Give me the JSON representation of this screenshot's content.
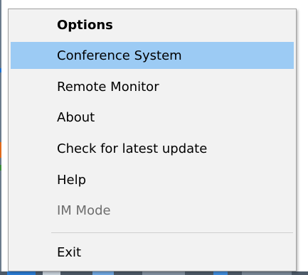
{
  "context_menu": {
    "items": [
      {
        "label": "Options",
        "style": "bold"
      },
      {
        "label": "Conference System",
        "state": "selected"
      },
      {
        "label": "Remote Monitor"
      },
      {
        "label": "About"
      },
      {
        "label": "Check for latest update"
      },
      {
        "label": "Help"
      },
      {
        "label": "IM Mode",
        "state": "disabled"
      },
      {
        "label": "Exit"
      }
    ]
  },
  "colors": {
    "menu_background": "#f2f2f2",
    "selection_highlight": "#9ccbf4",
    "disabled_text": "#6d6d6d",
    "menu_border": "#a0a0a0"
  }
}
